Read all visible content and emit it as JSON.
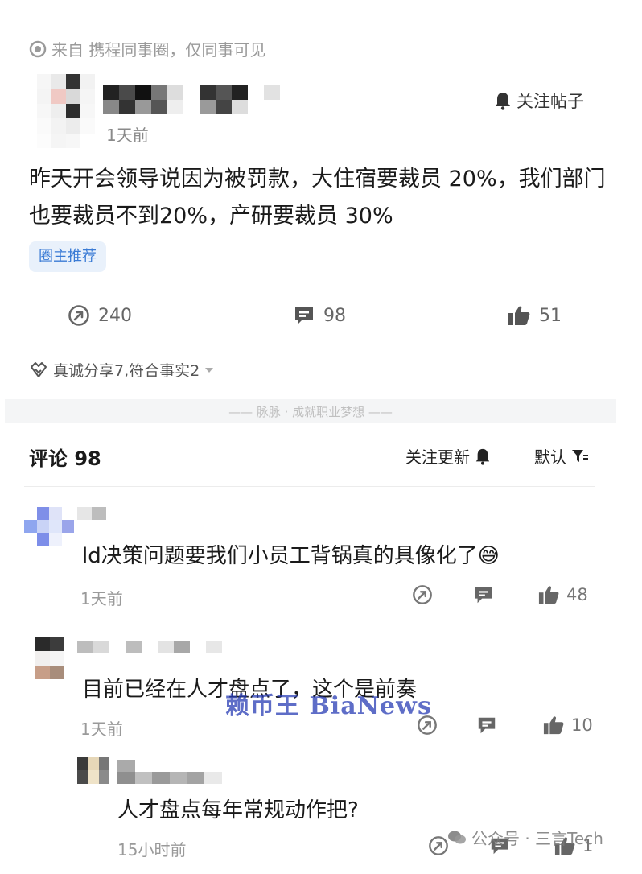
{
  "post": {
    "source": "来自 携程同事圈，仅同事可见",
    "time": "1天前",
    "follow_label": "关注帖子",
    "content": "昨天开会领导说因为被罚款，大住宿要裁员 20%，我们部门也要裁员不到20%，产研要裁员 30%",
    "badge": "圈主推荐",
    "stats": {
      "shares": "240",
      "comments": "98",
      "likes": "51"
    },
    "reactions": "真诚分享7,符合事实2"
  },
  "divider_text": "—— 脉脉 · 成就职业梦想 ——",
  "comments_section": {
    "title": "评论 98",
    "follow_updates_label": "关注更新",
    "sort_label": "默认"
  },
  "comments": [
    {
      "text": "ld决策问题要我们小员工背锅真的具像化了",
      "emoji": "😅",
      "time": "1天前",
      "likes": "48"
    },
    {
      "text": "目前已经在人才盘点了，这个是前奏",
      "time": "1天前",
      "likes": "10"
    },
    {
      "text": "人才盘点每年常规动作把?",
      "time": "15小时前",
      "likes": "1"
    }
  ],
  "watermarks": {
    "overlay": "赖币王 BiaNews",
    "wechat": "公众号 · 三言Tech"
  },
  "icons": [
    "eye-circle-icon",
    "bell-icon",
    "share-arrow-icon",
    "comment-bubble-icon",
    "thumbs-up-icon",
    "handshake-icon",
    "chevron-down-icon",
    "filter-sort-icon",
    "wechat-icon"
  ],
  "colors": {
    "badge_bg": "#e9f1fb",
    "badge_text": "#3a7bd5",
    "text": "#1a1a1a",
    "muted": "#8a8a8a"
  }
}
